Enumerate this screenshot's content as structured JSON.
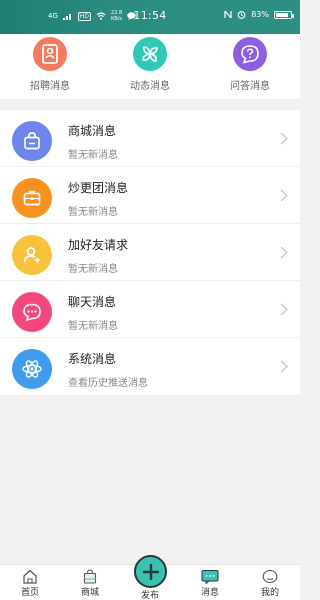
{
  "status_bar": {
    "network": "4G",
    "hd": "HD",
    "speed": "22.8",
    "speed_unit": "KB/s",
    "time": "11:54",
    "battery": "83%",
    "battery_level": 0.83
  },
  "quick_actions": [
    {
      "label": "招聘消息",
      "icon": "resume-icon",
      "color": "#f47a5a"
    },
    {
      "label": "动态消息",
      "icon": "fan-icon",
      "color": "#2fc9b5"
    },
    {
      "label": "问答消息",
      "icon": "question-bubble-icon",
      "color": "#8c5fe0"
    }
  ],
  "messages": [
    {
      "title": "商城消息",
      "subtitle": "暂无新消息",
      "icon": "shopping-bag-icon",
      "color": "#6d86ee"
    },
    {
      "title": "炒更团消息",
      "subtitle": "暂无新消息",
      "icon": "briefcase-icon",
      "color": "#f7921f"
    },
    {
      "title": "加好友请求",
      "subtitle": "暂无新消息",
      "icon": "add-user-icon",
      "color": "#f9c23e"
    },
    {
      "title": "聊天消息",
      "subtitle": "暂无新消息",
      "icon": "chat-bubble-icon",
      "color": "#f2487c"
    },
    {
      "title": "系统消息",
      "subtitle": "查看历史推送消息",
      "icon": "atom-icon",
      "color": "#3f9ced"
    }
  ],
  "bottom_nav": {
    "home": "首页",
    "mall": "商城",
    "publish": "发布",
    "messages": "消息",
    "mine": "我的"
  }
}
